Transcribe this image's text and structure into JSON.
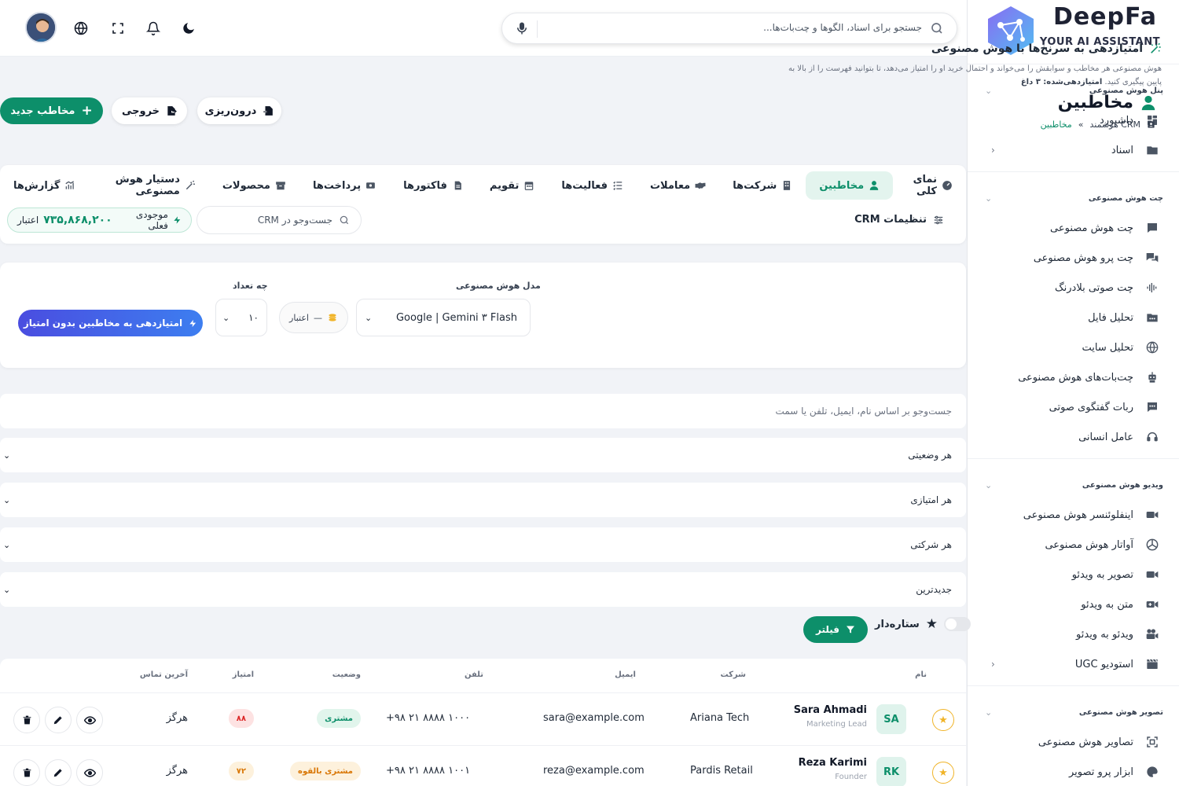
{
  "brand": {
    "name": "DeepFa",
    "tagline": "YOUR AI ASSISTANT"
  },
  "topbar": {
    "search_placeholder": "جستجو برای اسناد، الگوها و چت‌بات‌ها..."
  },
  "sidebar": {
    "sections": [
      {
        "title": "پنل هوش مصنوعی",
        "items": [
          {
            "label": "داشبورد",
            "icon": "dashboard-icon",
            "arrow": false
          },
          {
            "label": "اسناد",
            "icon": "folder-icon",
            "arrow": true
          }
        ]
      },
      {
        "title": "چت هوش مصنوعی",
        "items": [
          {
            "label": "چت هوش مصنوعی",
            "icon": "chat-icon",
            "arrow": false
          },
          {
            "label": "چت پرو هوش مصنوعی",
            "icon": "chat-pro-icon",
            "arrow": false
          },
          {
            "label": "چت صوتی بلادرنگ",
            "icon": "voice-wave-icon",
            "arrow": false
          },
          {
            "label": "تحلیل فایل",
            "icon": "file-analysis-icon",
            "arrow": false
          },
          {
            "label": "تحلیل سایت",
            "icon": "globe-icon",
            "arrow": false
          },
          {
            "label": "چت‌بات‌های هوش مصنوعی",
            "icon": "robot-icon",
            "arrow": false
          },
          {
            "label": "ربات گفتگوی صوتی",
            "icon": "voice-bot-icon",
            "arrow": false
          },
          {
            "label": "عامل انسانی",
            "icon": "headset-icon",
            "arrow": false
          }
        ]
      },
      {
        "title": "ویدیو هوش مصنوعی",
        "items": [
          {
            "label": "اینفلوئنسر هوش مصنوعی",
            "icon": "influencer-icon",
            "arrow": false
          },
          {
            "label": "آواتار هوش مصنوعی",
            "icon": "avatar-icon",
            "arrow": false
          },
          {
            "label": "تصویر به ویدئو",
            "icon": "video-camera-icon",
            "arrow": false
          },
          {
            "label": "متن به ویدئو",
            "icon": "text-video-icon",
            "arrow": false
          },
          {
            "label": "ویدئو به ویدئو",
            "icon": "video-video-icon",
            "arrow": false
          },
          {
            "label": "استودیو UGC",
            "icon": "studio-icon",
            "arrow": true
          }
        ]
      },
      {
        "title": "تصویر هوش مصنوعی",
        "items": [
          {
            "label": "تصاویر هوش مصنوعی",
            "icon": "image-scan-icon",
            "arrow": false
          },
          {
            "label": "ابزار پرو تصویر",
            "icon": "palette-icon",
            "arrow": false
          }
        ]
      }
    ]
  },
  "header": {
    "title": "مخاطبین",
    "breadcrumb": {
      "root": "CRM هوشمند",
      "sep": "»",
      "current": "مخاطبین"
    },
    "new_contact": "مخاطب جدید",
    "export": "خروجی",
    "import": "درون‌ریزی"
  },
  "tabs": [
    {
      "label": "نمای کلی",
      "icon": "overview-icon",
      "active": false
    },
    {
      "label": "مخاطبین",
      "icon": "contacts-icon",
      "active": true
    },
    {
      "label": "شرکت‌ها",
      "icon": "building-icon",
      "active": false
    },
    {
      "label": "معاملات",
      "icon": "handshake-icon",
      "active": false
    },
    {
      "label": "فعالیت‌ها",
      "icon": "activity-list-icon",
      "active": false
    },
    {
      "label": "تقویم",
      "icon": "calendar-icon",
      "active": false
    },
    {
      "label": "فاکتورها",
      "icon": "invoice-icon",
      "active": false
    },
    {
      "label": "پرداخت‌ها",
      "icon": "payment-icon",
      "active": false
    },
    {
      "label": "محصولات",
      "icon": "box-icon",
      "active": false
    },
    {
      "label": "دستیار هوش مصنوعی",
      "icon": "magic-wand-icon",
      "active": false
    },
    {
      "label": "گزارش‌ها",
      "icon": "chart-icon",
      "active": false
    }
  ],
  "crm": {
    "settings_label": "تنظیمات CRM",
    "search_placeholder": "جست‌وجو در CRM",
    "balance_label": "موجودی فعلی",
    "balance_amount": "۷۳۵,۸۶۸,۲۰۰",
    "balance_unit": "اعتبار"
  },
  "ai_scoring": {
    "title": "امتیازدهی به سرنخ‌ها با هوش مصنوعی",
    "desc_line1": "هوش مصنوعی هر مخاطب و سوابقش را می‌خواند و احتمال خرید او را امتیاز می‌دهد، تا بتوانید فهرست را از بالا به",
    "desc_line2a": "پایین پیگیری کنید.",
    "desc_line2b": "امتیازدهی‌شده: ۳ داغ",
    "model_label": "مدل هوش مصنوعی",
    "model_value": "Google | Gemini ۳ Flash",
    "credit_dash": "—",
    "credit_label": "اعتبار",
    "count_label": "چه تعداد",
    "count_value": "۱۰",
    "button": "امتیازدهی به مخاطبین بدون امتیاز"
  },
  "filters": {
    "search_placeholder": "جست‌وجو بر اساس نام، ایمیل، تلفن یا سمت",
    "status": "هر وضعیتی",
    "score": "هر امتیازی",
    "company": "هر شرکتی",
    "sort": "جدیدترین",
    "starred": "ستاره‌دار",
    "filter_button": "فیلتر"
  },
  "table": {
    "headers": {
      "name": "نام",
      "company": "شرکت",
      "email": "ایمیل",
      "phone": "تلفن",
      "status": "وضعیت",
      "score": "امتیاز",
      "last_contact": "آخرین تماس"
    },
    "rows": [
      {
        "initials": "SA",
        "name": "Sara Ahmadi",
        "role": "Marketing Lead",
        "company": "Ariana Tech",
        "email": "sara@example.com",
        "phone": "+۹۸ ۲۱ ۸۸۸۸ ۱۰۰۰",
        "status": "مشتری",
        "status_color": "#0d8f6a",
        "status_bg": "#e1f5ec",
        "score": "۸۸",
        "score_color": "#dc2626",
        "score_bg": "#fde2e2",
        "last_contact": "هرگز"
      },
      {
        "initials": "RK",
        "name": "Reza Karimi",
        "role": "Founder",
        "company": "Pardis Retail",
        "email": "reza@example.com",
        "phone": "+۹۸ ۲۱ ۸۸۸۸ ۱۰۰۱",
        "status": "مشتری بالقوه",
        "status_color": "#d97706",
        "status_bg": "#fdf1dc",
        "score": "۷۲",
        "score_color": "#d97706",
        "score_bg": "#fdf1dc",
        "last_contact": "هرگز"
      }
    ]
  },
  "colors": {
    "primary": "#0d8f6a",
    "accent_gradient_start": "#4a4de0",
    "accent_gradient_end": "#3d7ef0",
    "star": "#f0b429"
  }
}
